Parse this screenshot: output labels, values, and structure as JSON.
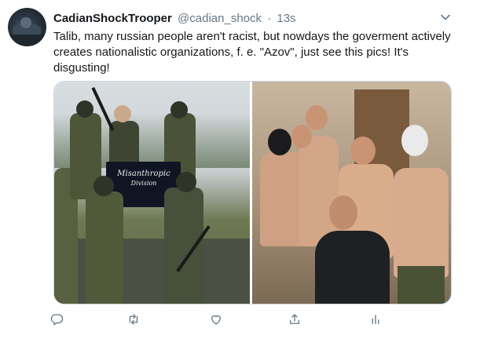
{
  "tweet": {
    "display_name": "CadianShockTrooper",
    "handle": "@cadian_shock",
    "separator": "·",
    "time": "13s",
    "text": "Talib, many russian people aren't racist, but nowdays the goverment actively creates nationalistic organizations, f. e. \"Azov\", just see this pics! It's disgusting!"
  },
  "media": {
    "left_photo": {
      "flag_line1": "Misanthropic",
      "flag_line2": "Division"
    }
  },
  "icons": {
    "menu": "chevron-down-icon",
    "reply": "reply-icon",
    "retweet": "retweet-icon",
    "like": "heart-icon",
    "share": "share-icon",
    "analytics": "analytics-icon"
  },
  "colors": {
    "text": "#14171a",
    "secondary": "#657786",
    "border": "#ccd6dd"
  }
}
